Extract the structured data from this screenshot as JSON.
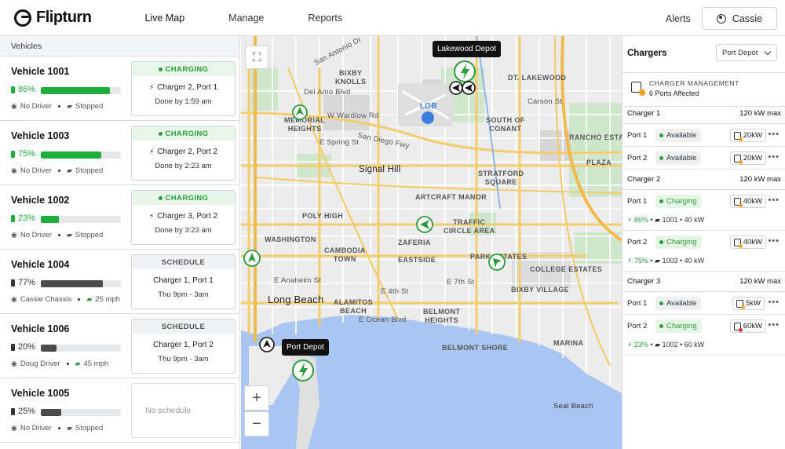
{
  "header": {
    "brand": "Flipturn",
    "nav": [
      {
        "label": "Live Map",
        "active": true
      },
      {
        "label": "Manage",
        "active": false
      },
      {
        "label": "Reports",
        "active": false
      }
    ],
    "alerts_label": "Alerts",
    "user_name": "Cassie"
  },
  "vehicles": {
    "heading": "Vehicles",
    "items": [
      {
        "name": "Vehicle 1001",
        "battery": "86%",
        "battery_value": 0.86,
        "bar_color": "#1fae3b",
        "pct_color": "#1fae3b",
        "driver": "No Driver",
        "status": "Stopped",
        "card": {
          "type": "charging",
          "header": "CHARGING",
          "line1": "Charger 2, Port 1",
          "line2": "Done by 1:59 am"
        }
      },
      {
        "name": "Vehicle 1003",
        "battery": "75%",
        "battery_value": 0.75,
        "bar_color": "#1fae3b",
        "pct_color": "#1fae3b",
        "driver": "No Driver",
        "status": "Stopped",
        "card": {
          "type": "charging",
          "header": "CHARGING",
          "line1": "Charger 2, Port 2",
          "line2": "Done by 2:23 am"
        }
      },
      {
        "name": "Vehicle 1002",
        "battery": "23%",
        "battery_value": 0.23,
        "bar_color": "#1fae3b",
        "pct_color": "#1fae3b",
        "driver": "No Driver",
        "status": "Stopped",
        "card": {
          "type": "charging",
          "header": "CHARGING",
          "line1": "Charger 3, Port 2",
          "line2": "Done by 3:23 am"
        }
      },
      {
        "name": "Vehicle 1004",
        "battery": "77%",
        "battery_value": 0.77,
        "bar_color": "#4a4a4a",
        "pct_color": "#333333",
        "driver": "Cassie Chassis",
        "status": "25 mph",
        "card": {
          "type": "schedule",
          "header": "SCHEDULE",
          "line1": "Charger 1, Port 1",
          "line2": "Thu 9pm - 3am"
        }
      },
      {
        "name": "Vehicle 1006",
        "battery": "20%",
        "battery_value": 0.2,
        "bar_color": "#4a4a4a",
        "pct_color": "#333333",
        "driver": "Doug Driver",
        "status": "45 mph",
        "card": {
          "type": "schedule",
          "header": "SCHEDULE",
          "line1": "Charger 1, Port 2",
          "line2": "Thu 9pm - 3am"
        }
      },
      {
        "name": "Vehicle 1005",
        "battery": "25%",
        "battery_value": 0.25,
        "bar_color": "#4a4a4a",
        "pct_color": "#333333",
        "driver": "No Driver",
        "status": "Stopped",
        "card": {
          "type": "empty",
          "header": "",
          "line1": "No schedule",
          "line2": ""
        }
      }
    ]
  },
  "map": {
    "depots": [
      "Lakewood Depot",
      "Port Depot"
    ],
    "labels": {
      "san_antonio_dr": "San Antonio Dr",
      "memorial_heights": "MEMORIAL\nHEIGHTS",
      "wardlow": "W Wardlow Rd",
      "lgb": "LGB",
      "del_amo": "Del Amo Blvd",
      "bixby_knolls": "BIXBY\nKNOLLS",
      "dt_lakewood": "DT. LAKEWOOD",
      "carson_st": "Carson St",
      "south_conant": "SOUTH OF\nCONANT",
      "san_diego_fwy": "San Diego Fwy",
      "rancho_estates": "RANCHO ESTATES",
      "signal_hill": "Signal Hill",
      "stratford_square": "STRATFORD\nSQUARE",
      "plaza": "PLAZA",
      "artcraft_manor": "ARTCRAFT MANOR",
      "poly_high": "POLY HIGH",
      "traffic_circle": "TRAFFIC\nCIRCLE AREA",
      "washington": "WASHINGTON",
      "zafeiria": "ZAFERIA",
      "cambodia_town": "CAMBODIA\nTOWN",
      "eastside": "EASTSIDE",
      "park_estates": "PARK ESTATES",
      "college_estates": "COLLEGE ESTATES",
      "bixby_village": "BIXBY VILLAGE",
      "long_beach": "Long Beach",
      "alamitos": "ALAMITOS\nBEACH",
      "belmont": "BELMONT\nHEIGHTS",
      "belmont_shore": "BELMONT SHORE",
      "marina": "MARINA",
      "seal_beach": "Seal Beach",
      "e_7th": "E 7th St",
      "e_ocean": "E Ocean Blvd",
      "e_4th": "E 4th St",
      "e_spring": "E Spring St",
      "e_anaheim": "E Anaheim St"
    },
    "zoom_in": "+",
    "zoom_out": "−"
  },
  "chargers": {
    "title": "Chargers",
    "location_select": "Port Depot",
    "management": {
      "title": "CHARGER MANAGEMENT",
      "subtitle": "6 Ports Affected"
    },
    "groups": [
      {
        "name": "Charger 1",
        "max": "120 kW max",
        "ports": [
          {
            "label": "Port 1",
            "status": "Available",
            "kw": "20kW",
            "sub": null
          },
          {
            "label": "Port 2",
            "status": "Available",
            "kw": "20kW",
            "sub": null
          }
        ]
      },
      {
        "name": "Charger 2",
        "max": "120 kW max",
        "ports": [
          {
            "label": "Port 1",
            "status": "Charging",
            "kw": "40kW",
            "sub": {
              "pct": "86%",
              "vehicle": "1001",
              "power": "40 kW"
            }
          },
          {
            "label": "Port 2",
            "status": "Charging",
            "kw": "40kW",
            "sub": {
              "pct": "75%",
              "vehicle": "1003",
              "power": "40 kW"
            }
          }
        ]
      },
      {
        "name": "Charger 3",
        "max": "120 kW max",
        "ports": [
          {
            "label": "Port 1",
            "status": "Available",
            "kw": "5kW",
            "sub": null
          },
          {
            "label": "Port 2",
            "status": "Charging",
            "kw": "60kW",
            "sub": {
              "pct": "23%",
              "vehicle": "1002",
              "power": "60 kW"
            }
          }
        ]
      }
    ]
  },
  "colors": {
    "accent_green": "#1fae3b",
    "charging_bg": "#e5f5e6",
    "warning": "#f0a020",
    "alert": "#d9342b"
  }
}
